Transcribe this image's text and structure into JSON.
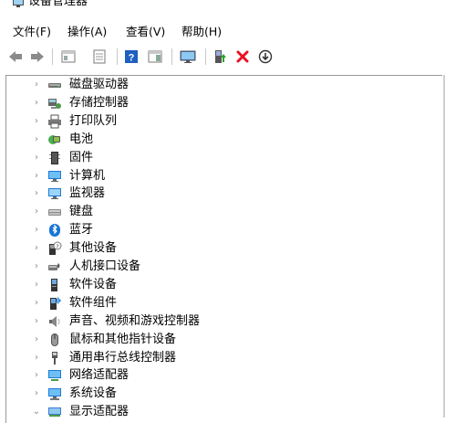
{
  "window": {
    "title": "设备管理器"
  },
  "menu": [
    {
      "label": "文件(F)"
    },
    {
      "label": "操作(A)"
    },
    {
      "label": "查看(V)"
    },
    {
      "label": "帮助(H)"
    }
  ],
  "toolbar": [
    {
      "name": "back-icon"
    },
    {
      "name": "forward-icon"
    },
    {
      "name": "show-hide-console-tree-icon"
    },
    {
      "name": "properties-icon"
    },
    {
      "name": "help-icon"
    },
    {
      "name": "action-pane-icon"
    },
    {
      "name": "monitor-icon"
    },
    {
      "name": "update-driver-icon"
    },
    {
      "name": "uninstall-device-icon"
    },
    {
      "name": "disable-device-icon"
    }
  ],
  "tree": {
    "items": [
      {
        "label": "磁盘驱动器",
        "icon": "disk-drive-icon",
        "expanded": false
      },
      {
        "label": "存储控制器",
        "icon": "storage-controller-icon",
        "expanded": false
      },
      {
        "label": "打印队列",
        "icon": "printer-icon",
        "expanded": false
      },
      {
        "label": "电池",
        "icon": "battery-icon",
        "expanded": false
      },
      {
        "label": "固件",
        "icon": "firmware-icon",
        "expanded": false
      },
      {
        "label": "计算机",
        "icon": "computer-icon",
        "expanded": false
      },
      {
        "label": "监视器",
        "icon": "monitor-icon",
        "expanded": false
      },
      {
        "label": "键盘",
        "icon": "keyboard-icon",
        "expanded": false
      },
      {
        "label": "蓝牙",
        "icon": "bluetooth-icon",
        "expanded": false
      },
      {
        "label": "其他设备",
        "icon": "other-devices-icon",
        "expanded": false
      },
      {
        "label": "人机接口设备",
        "icon": "hid-icon",
        "expanded": false
      },
      {
        "label": "软件设备",
        "icon": "software-device-icon",
        "expanded": false
      },
      {
        "label": "软件组件",
        "icon": "software-component-icon",
        "expanded": false
      },
      {
        "label": "声音、视频和游戏控制器",
        "icon": "sound-icon",
        "expanded": false
      },
      {
        "label": "鼠标和其他指针设备",
        "icon": "mouse-icon",
        "expanded": false
      },
      {
        "label": "通用串行总线控制器",
        "icon": "usb-icon",
        "expanded": false
      },
      {
        "label": "网络适配器",
        "icon": "network-adapter-icon",
        "expanded": false
      },
      {
        "label": "系统设备",
        "icon": "system-devices-icon",
        "expanded": false
      },
      {
        "label": "显示适配器",
        "icon": "display-adapter-icon",
        "expanded": true
      }
    ]
  },
  "colors": {
    "accent": "#0078d7",
    "delete": "#e81123"
  }
}
